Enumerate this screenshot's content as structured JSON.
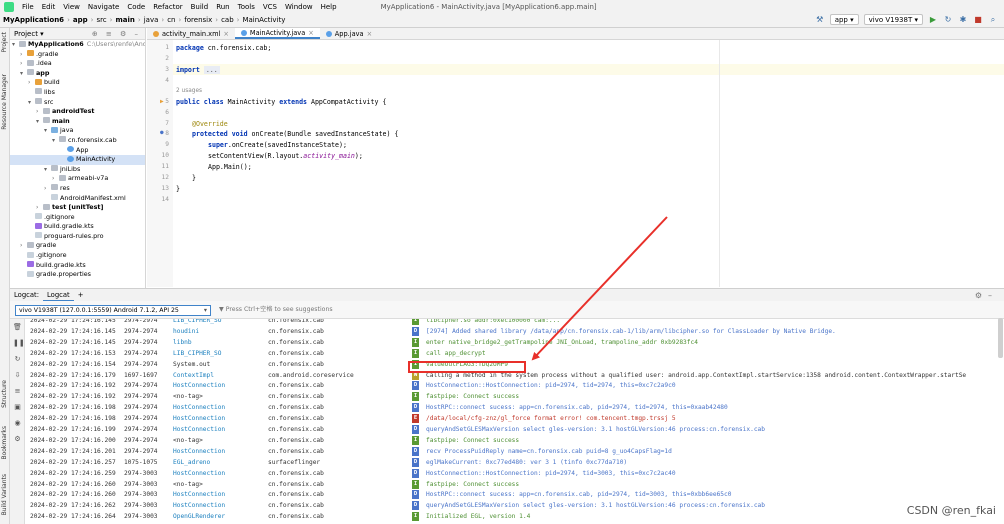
{
  "menubar": {
    "items": [
      "File",
      "Edit",
      "View",
      "Navigate",
      "Code",
      "Refactor",
      "Build",
      "Run",
      "Tools",
      "VCS",
      "Window",
      "Help"
    ],
    "title": "MyApplication6 - MainActivity.java [MyApplication6.app.main]"
  },
  "breadcrumb": [
    "MyApplication6",
    "app",
    "src",
    "main",
    "java",
    "cn",
    "forensix",
    "cab",
    "MainActivity"
  ],
  "toolbar": {
    "run_config": "app",
    "device": "vivo V1938T"
  },
  "project_panel": {
    "title": "Project",
    "rows": [
      {
        "label": "MyApplication6",
        "extra": "C:\\Users\\renfe\\Andro",
        "indent": 0,
        "arrow": "▾",
        "icon": "f-folder",
        "bold": true
      },
      {
        "label": ".gradle",
        "indent": 1,
        "arrow": "›",
        "icon": "f-build"
      },
      {
        "label": ".idea",
        "indent": 1,
        "arrow": "›",
        "icon": "f-folder"
      },
      {
        "label": "app",
        "indent": 1,
        "arrow": "▾",
        "icon": "f-folder",
        "bold": true
      },
      {
        "label": "build",
        "indent": 2,
        "arrow": "›",
        "icon": "f-build"
      },
      {
        "label": "libs",
        "indent": 2,
        "arrow": "",
        "icon": "f-folder"
      },
      {
        "label": "src",
        "indent": 2,
        "arrow": "▾",
        "icon": "f-folder"
      },
      {
        "label": "androidTest",
        "indent": 3,
        "arrow": "›",
        "icon": "f-folder",
        "bold": true
      },
      {
        "label": "main",
        "indent": 3,
        "arrow": "▾",
        "icon": "f-folder",
        "bold": true
      },
      {
        "label": "java",
        "indent": 4,
        "arrow": "▾",
        "icon": "f-src"
      },
      {
        "label": "cn.forensix.cab",
        "indent": 5,
        "arrow": "▾",
        "icon": "f-folder"
      },
      {
        "label": "App",
        "indent": 6,
        "arrow": "",
        "icon": "f-class"
      },
      {
        "label": "MainActivity",
        "indent": 6,
        "arrow": "",
        "icon": "f-class",
        "selected": true
      },
      {
        "label": "jniLibs",
        "indent": 4,
        "arrow": "▾",
        "icon": "f-folder"
      },
      {
        "label": "armeabi-v7a",
        "indent": 5,
        "arrow": "›",
        "icon": "f-folder"
      },
      {
        "label": "res",
        "indent": 4,
        "arrow": "›",
        "icon": "f-folder"
      },
      {
        "label": "AndroidManifest.xml",
        "indent": 4,
        "arrow": "",
        "icon": "f-file"
      },
      {
        "label": "test [unitTest]",
        "indent": 3,
        "arrow": "›",
        "icon": "f-folder",
        "bold": true
      },
      {
        "label": ".gitignore",
        "indent": 2,
        "arrow": "",
        "icon": "f-file"
      },
      {
        "label": "build.gradle.kts",
        "indent": 2,
        "arrow": "",
        "icon": "f-kotlin"
      },
      {
        "label": "proguard-rules.pro",
        "indent": 2,
        "arrow": "",
        "icon": "f-file"
      },
      {
        "label": "gradle",
        "indent": 1,
        "arrow": "›",
        "icon": "f-folder"
      },
      {
        "label": ".gitignore",
        "indent": 1,
        "arrow": "",
        "icon": "f-file"
      },
      {
        "label": "build.gradle.kts",
        "indent": 1,
        "arrow": "",
        "icon": "f-kotlin"
      },
      {
        "label": "gradle.properties",
        "indent": 1,
        "arrow": "",
        "icon": "f-file"
      }
    ]
  },
  "editor_tabs": [
    {
      "label": "activity_main.xml",
      "active": false
    },
    {
      "label": "MainActivity.java",
      "active": true
    },
    {
      "label": "App.java",
      "active": false
    }
  ],
  "editor": {
    "line_numbers": [
      "1",
      "2",
      "3",
      "4",
      "5",
      "6",
      "7",
      "8",
      "9",
      "10",
      "11",
      "12",
      "13",
      "14"
    ],
    "usages_hint": "2 usages",
    "code": {
      "l1_kw": "package",
      "l1_rest": " cn.forensix.cab;",
      "l3_kw": "import",
      "l3_rest": " ...",
      "l5_kw": "public class",
      "l5_name": " MainActivity ",
      "l5_kw2": "extends",
      "l5_rest": " AppCompatActivity {",
      "l7": "@Override",
      "l8_kw": "protected void",
      "l8_rest": " onCreate(Bundle savedInstanceState) {",
      "l9_kw": "super",
      "l9_rest": ".onCreate(savedInstanceState);",
      "l10_pre": "setContentView(R.layout.",
      "l10_fld": "activity_main",
      "l10_post": ");",
      "l11": "App.Main();",
      "l12": "}",
      "l13": "}"
    }
  },
  "logcat": {
    "tabs": [
      "Logcat:",
      "Logcat"
    ],
    "add_tab": "+",
    "device_select": "vivo V1938T (127.0.0.1:5559) Android 7.1.2, API 25",
    "filter_placeholder": "Press Ctrl+空格 to see suggestions",
    "rows": [
      {
        "ts": "2024-02-29 17:24:16.145",
        "pid": "2974-2974",
        "tag": "LIB_CIPHER_SO",
        "pkg": "cn.forensix.cab",
        "lvl": "I",
        "msg": "libcipher.so addr:0xec100000 cam:..."
      },
      {
        "ts": "2024-02-29 17:24:16.145",
        "pid": "2974-2974",
        "tag": "houdini",
        "pkg": "cn.forensix.cab",
        "lvl": "D",
        "msg": "[2974] Added shared library /data/app/cn.forensix.cab-1/lib/arm/libcipher.so for ClassLoader by Native Bridge."
      },
      {
        "ts": "2024-02-29 17:24:16.145",
        "pid": "2974-2974",
        "tag": "libnb",
        "pkg": "cn.forensix.cab",
        "lvl": "I",
        "msg": "enter native_bridge2_getTrampoline JNI_OnLoad, trampoline_addr 0xb9283fc4"
      },
      {
        "ts": "2024-02-29 17:24:16.153",
        "pid": "2974-2974",
        "tag": "LIB_CIPHER_SO",
        "pkg": "cn.forensix.cab",
        "lvl": "I",
        "msg": "call app_decrypt"
      },
      {
        "ts": "2024-02-29 17:24:16.154",
        "pid": "2974-2974",
        "tag": "System.out",
        "pkg": "cn.forensix.cab",
        "lvl": "I",
        "msg": "valueOutFLAG3:TDQ2UMP9"
      },
      {
        "ts": "2024-02-29 17:24:16.179",
        "pid": "1697-1697",
        "tag": "ContextImpl",
        "pkg": "com.android.coreservice",
        "lvl": "W",
        "msg": "Calling a method in the system process without a qualified user: android.app.ContextImpl.startService:1358 android.content.ContextWrapper.startSe"
      },
      {
        "ts": "2024-02-29 17:24:16.192",
        "pid": "2974-2974",
        "tag": "HostConnection",
        "pkg": "cn.forensix.cab",
        "lvl": "D",
        "msg": "HostConnection::HostConnection: pid=2974, tid=2974, this=0xc7c2a9c0"
      },
      {
        "ts": "2024-02-29 17:24:16.192",
        "pid": "2974-2974",
        "tag": "<no-tag>",
        "pkg": "cn.forensix.cab",
        "lvl": "I",
        "msg": "fastpipe: Connect success",
        "plain": true
      },
      {
        "ts": "2024-02-29 17:24:16.198",
        "pid": "2974-2974",
        "tag": "HostConnection",
        "pkg": "cn.forensix.cab",
        "lvl": "D",
        "msg": "HostRPC::connect sucess: app=cn.forensix.cab, pid=2974, tid=2974, this=0xaab42480"
      },
      {
        "ts": "2024-02-29 17:24:16.198",
        "pid": "2974-2974",
        "tag": "HostConnection",
        "pkg": "cn.forensix.cab",
        "lvl": "E",
        "msg": "/data/local/cfg-znz/gl_force format error! com.tencent.tmgp.trssj 5"
      },
      {
        "ts": "2024-02-29 17:24:16.199",
        "pid": "2974-2974",
        "tag": "HostConnection",
        "pkg": "cn.forensix.cab",
        "lvl": "D",
        "msg": "queryAndSetGLESMaxVersion select gles-version: 3.1 hostGLVersion:46 process:cn.forensix.cab"
      },
      {
        "ts": "2024-02-29 17:24:16.200",
        "pid": "2974-2974",
        "tag": "<no-tag>",
        "pkg": "cn.forensix.cab",
        "lvl": "I",
        "msg": "fastpipe: Connect success",
        "plain": true
      },
      {
        "ts": "2024-02-29 17:24:16.201",
        "pid": "2974-2974",
        "tag": "HostConnection",
        "pkg": "cn.forensix.cab",
        "lvl": "D",
        "msg": "recv ProcessPuidReply name=cn.forensix.cab puid=8 g_uo4CapsFlag=1d"
      },
      {
        "ts": "2024-02-29 17:24:16.257",
        "pid": "1075-1075",
        "tag": "EGL_adreno",
        "pkg": "surfaceflinger",
        "lvl": "D",
        "msg": "eglMakeCurrent: 0xc77ed480: ver 3 1 (tinfo 0xc77da710)"
      },
      {
        "ts": "2024-02-29 17:24:16.259",
        "pid": "2974-3003",
        "tag": "HostConnection",
        "pkg": "cn.forensix.cab",
        "lvl": "D",
        "msg": "HostConnection::HostConnection: pid=2974, tid=3003, this=0xc7c2ac40"
      },
      {
        "ts": "2024-02-29 17:24:16.260",
        "pid": "2974-3003",
        "tag": "<no-tag>",
        "pkg": "cn.forensix.cab",
        "lvl": "I",
        "msg": "fastpipe: Connect success",
        "plain": true
      },
      {
        "ts": "2024-02-29 17:24:16.260",
        "pid": "2974-3003",
        "tag": "HostConnection",
        "pkg": "cn.forensix.cab",
        "lvl": "D",
        "msg": "HostRPC::connect sucess: app=cn.forensix.cab, pid=2974, tid=3003, this=0xbb6ee65c0"
      },
      {
        "ts": "2024-02-29 17:24:16.262",
        "pid": "2974-3003",
        "tag": "HostConnection",
        "pkg": "cn.forensix.cab",
        "lvl": "D",
        "msg": "queryAndSetGLESMaxVersion select gles-version: 3.1 hostGLVersion:46 process:cn.forensix.cab"
      },
      {
        "ts": "2024-02-29 17:24:16.264",
        "pid": "2974-3003",
        "tag": "OpenGLRenderer",
        "pkg": "cn.forensix.cab",
        "lvl": "I",
        "msg": "Initialized EGL, version 1.4"
      }
    ]
  },
  "left_tool_tabs": [
    "Project",
    "Resource Manager",
    "Structure",
    "Bookmarks",
    "Build Variants"
  ],
  "watermark": "CSDN @ren_fkai"
}
